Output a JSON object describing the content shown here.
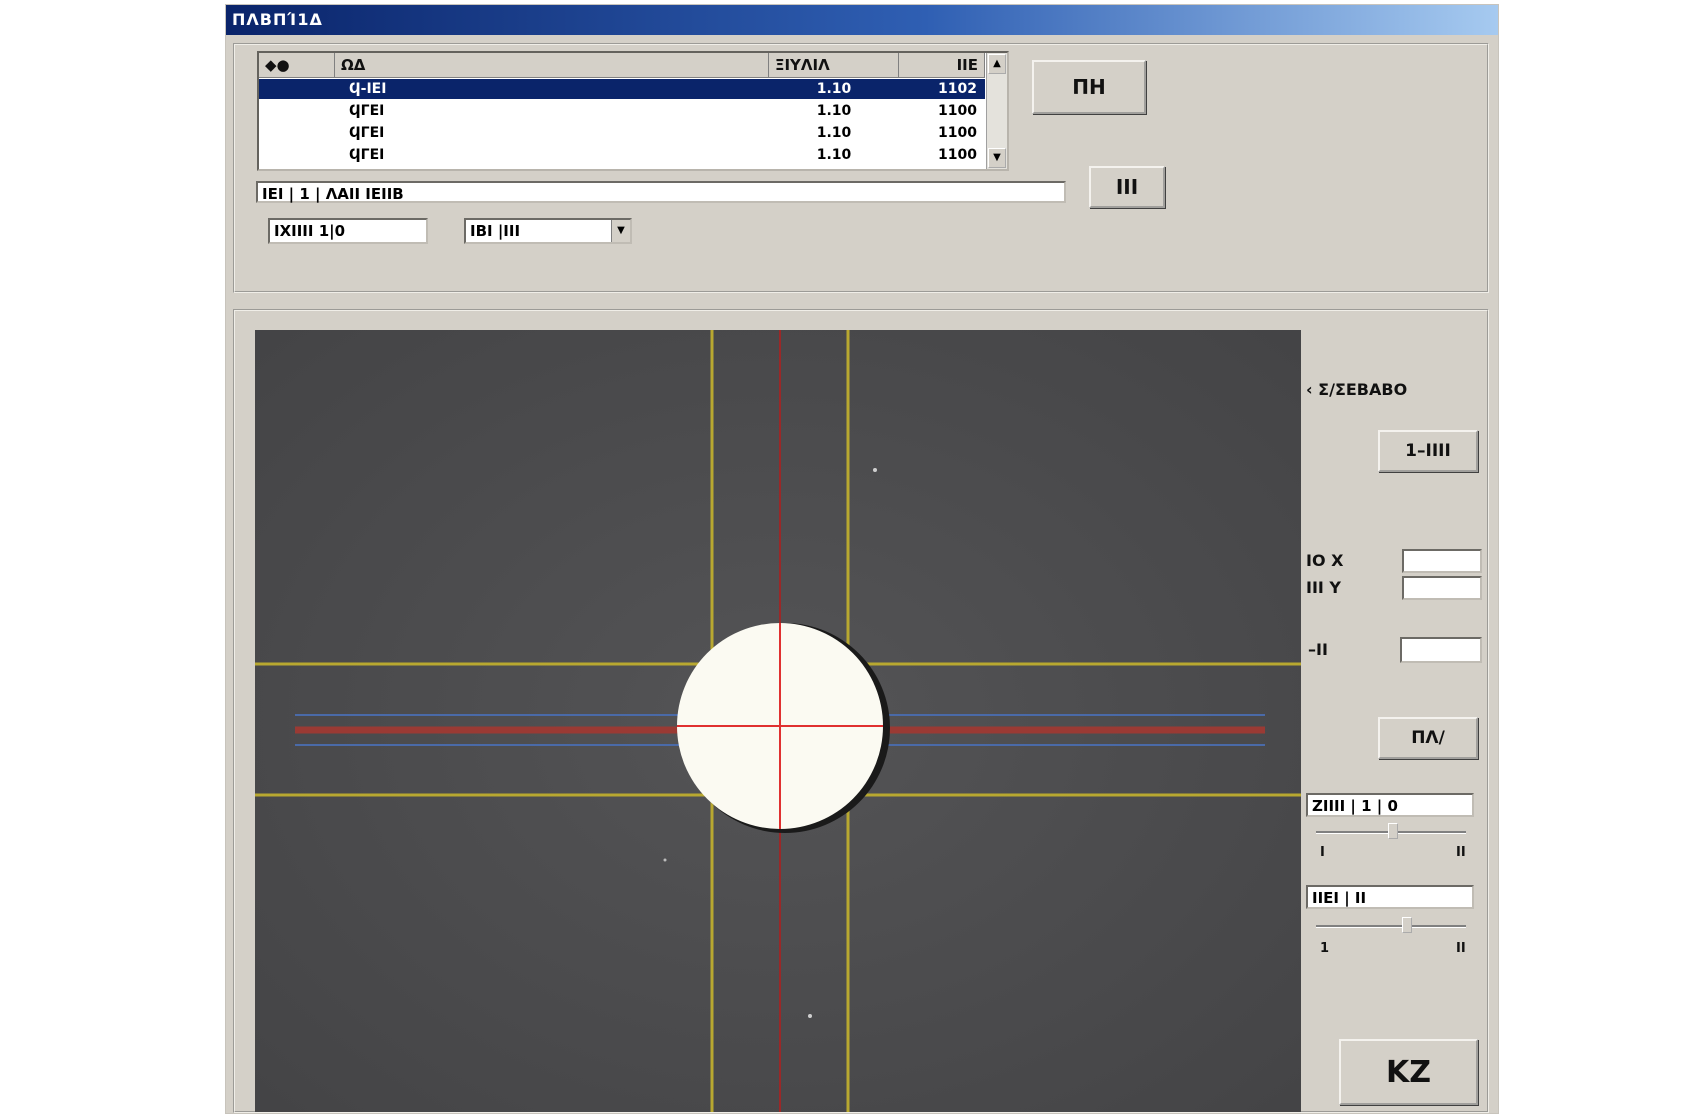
{
  "window": {
    "title": "ΠΛΒΠΊ1Δ"
  },
  "table": {
    "headers": [
      "◆●",
      "ΩΔ",
      "ΞΙΥΛΙΛ",
      "ΙΙΕ"
    ],
    "rows": [
      {
        "name": "Ϥ-ΙΕΙ",
        "value": "1.10",
        "count": "1102"
      },
      {
        "name": "ϤΓΕΙ",
        "value": "1.10",
        "count": "1100"
      },
      {
        "name": "ϤΓΕΙ",
        "value": "1.10",
        "count": "1100"
      },
      {
        "name": "ϤΓΕΙ",
        "value": "1.10",
        "count": "1100"
      }
    ]
  },
  "top_buttons": {
    "primary": "ΠΗ",
    "secondary": "ΙΙΙ"
  },
  "status_field": {
    "value": "ΙΕΙ | 1 | ΛΑΙΙ ΙΕΙΙΒ"
  },
  "combo_left": {
    "value": "ΙΧΙΙΙΙ 1|0"
  },
  "combo_mid": {
    "value": "ΙΒΙ |ΙΙΙ"
  },
  "right_panel": {
    "heading": "‹ Σ/ΣΕΒΑΒΟ",
    "button1": "1–ΙΙΙΙ",
    "coord_x_label": "ΙΟ X",
    "coord_y_label": "ΙΙΙ Y",
    "value_label": "–ΙΙ",
    "button2": "ΠΛ/",
    "combo1": "ΖΙΙΙΙ | 1 | 0",
    "slider1_ticks": [
      "Ι",
      "ΙΙ"
    ],
    "combo2": "ΙΙΕΙ | ΙΙ",
    "slider2_ticks": [
      "1",
      "ΙΙ"
    ],
    "big_button": "ΚΖ"
  },
  "colors": {
    "titlebar_start": "#0a246a",
    "selection": "#0a246a",
    "viewer_bg": "#4a4a4c",
    "guide_yellow": "#b8a830",
    "guide_red": "#c02020",
    "guide_blue": "#4a6aa8",
    "target_fill": "#fbfaf2"
  }
}
